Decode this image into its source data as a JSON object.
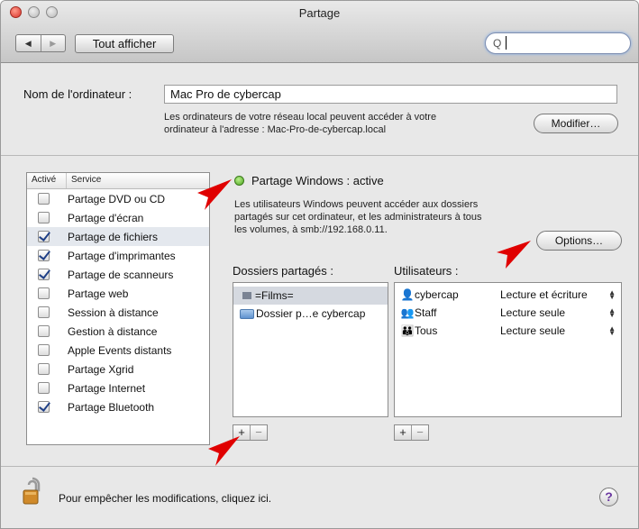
{
  "window": {
    "title": "Partage"
  },
  "toolbar": {
    "back": "◀",
    "forward": "▶",
    "show_all": "Tout afficher",
    "search_value": ""
  },
  "computer_name": {
    "label": "Nom de l'ordinateur :",
    "value": "Mac Pro de cybercap",
    "note_line1": "Les ordinateurs de votre réseau local peuvent accéder à votre",
    "note_line2": "ordinateur à l'adresse : Mac-Pro-de-cybercap.local",
    "modify_button": "Modifier…"
  },
  "services": {
    "col_active": "Activé",
    "col_service": "Service",
    "items": [
      {
        "name": "Partage DVD ou CD",
        "checked": false
      },
      {
        "name": "Partage d'écran",
        "checked": false
      },
      {
        "name": "Partage de fichiers",
        "checked": true
      },
      {
        "name": "Partage d'imprimantes",
        "checked": true
      },
      {
        "name": "Partage de scanneurs",
        "checked": true
      },
      {
        "name": "Partage web",
        "checked": false
      },
      {
        "name": "Session à distance",
        "checked": false
      },
      {
        "name": "Gestion à distance",
        "checked": false
      },
      {
        "name": "Apple Events distants",
        "checked": false
      },
      {
        "name": "Partage Xgrid",
        "checked": false
      },
      {
        "name": "Partage Internet",
        "checked": false
      },
      {
        "name": "Partage Bluetooth",
        "checked": true
      }
    ]
  },
  "status": {
    "title": "Partage Windows : active",
    "desc_line1": "Les utilisateurs Windows peuvent accéder aux dossiers",
    "desc_line2": "partagés sur cet ordinateur, et les administrateurs à tous",
    "desc_line3": "les volumes, à smb://192.168.0.11.",
    "options_button": "Options…",
    "status_color": "#4ca51f"
  },
  "shared_folders": {
    "label": "Dossiers partagés :",
    "items": [
      "=Films=",
      "Dossier p…e cybercap"
    ]
  },
  "users": {
    "label": "Utilisateurs :",
    "items": [
      {
        "name": "cybercap",
        "rights": "Lecture et écriture",
        "icon": "person-icon"
      },
      {
        "name": "Staff",
        "rights": "Lecture seule",
        "icon": "group-icon"
      },
      {
        "name": "Tous",
        "rights": "Lecture seule",
        "icon": "everyone-icon"
      }
    ]
  },
  "buttons": {
    "add": "+",
    "remove": "−"
  },
  "footer": {
    "lock_text": "Pour empêcher les modifications, cliquez ici.",
    "help": "?"
  },
  "colors": {
    "arrow": "#e00000",
    "selection": "#d5d9e0"
  }
}
